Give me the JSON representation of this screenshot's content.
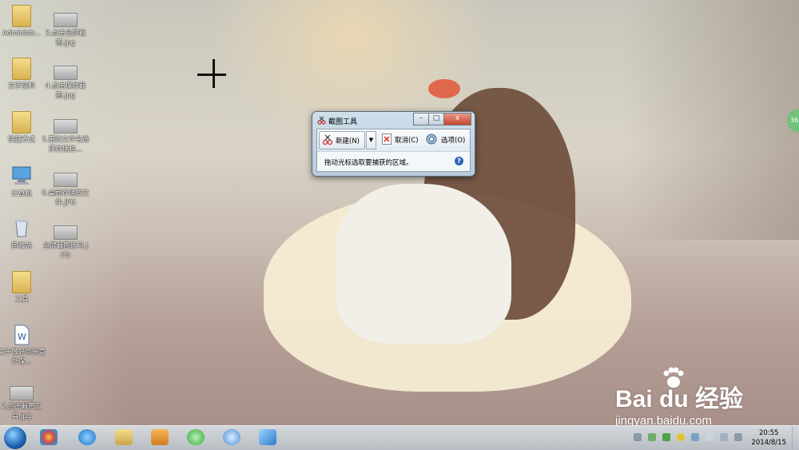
{
  "desktop": {
    "icons": [
      {
        "label": "Administr...",
        "kind": "user-folder"
      },
      {
        "label": "3.点击全屏截图.jpg",
        "kind": "image"
      },
      {
        "label": "文字资料",
        "kind": "folder"
      },
      {
        "label": "4.点击保存截图.jpg",
        "kind": "image"
      },
      {
        "label": "快捷方式",
        "kind": "folder"
      },
      {
        "label": "5.更改文件名选择存储位...",
        "kind": "image"
      },
      {
        "label": "计算机",
        "kind": "computer"
      },
      {
        "label": "6.桌面存储的文件.JPG",
        "kind": "image"
      },
      {
        "label": "回收站",
        "kind": "recycle-bin"
      },
      {
        "label": "全屏截图练习.JPG",
        "kind": "image"
      },
      {
        "label": "工具",
        "kind": "folder"
      },
      {
        "label": "关于做好劳务意外保...",
        "kind": "document"
      },
      {
        "label": "2.点击截图工具.jpg",
        "kind": "image"
      }
    ],
    "side_badge": "36"
  },
  "snipping_tool": {
    "title": "截图工具",
    "new_label": "新建(N)",
    "cancel_label": "取消(C)",
    "options_label": "选项(O)",
    "hint": "拖动光标选取要捕获的区域。",
    "help": "?",
    "window_buttons": {
      "minimize": "–",
      "maximize": "□",
      "close": "x"
    }
  },
  "watermark": {
    "brand": "Bai du 经验",
    "url": "jingyan.baidu.com"
  },
  "taskbar": {
    "apps": [
      "start-orb",
      "360-icon",
      "ie-icon",
      "explorer-icon",
      "media-player-icon",
      "360-browser-icon",
      "chat-icon",
      "bird-icon"
    ],
    "time": "20:55",
    "date": "2014/8/15"
  }
}
